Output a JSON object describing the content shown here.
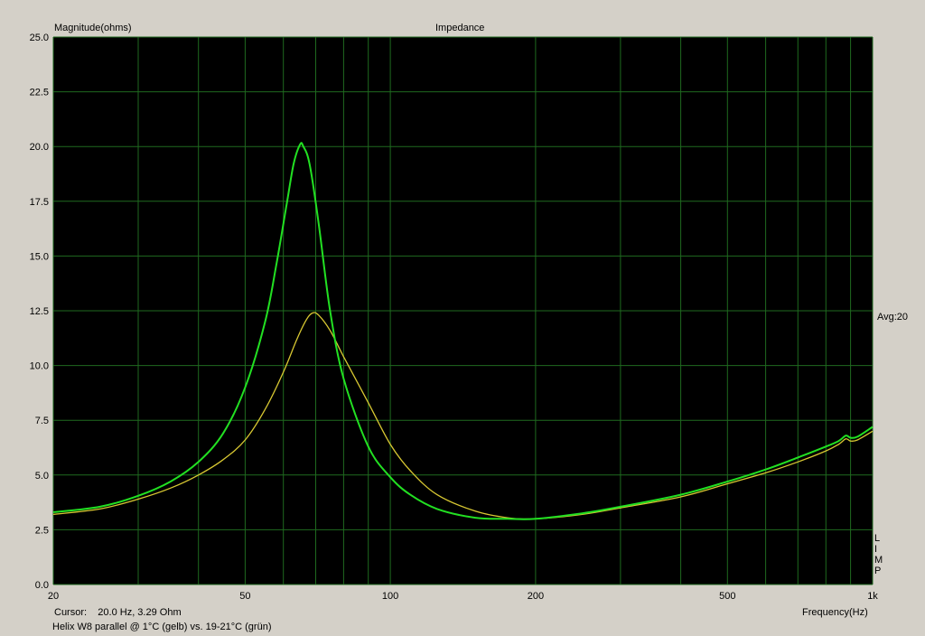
{
  "chart_data": {
    "type": "line",
    "title": "Impedance",
    "ylabel": "Magnitude(ohms)",
    "xlabel": "Frequency(Hz)",
    "x_scale": "log",
    "xlim": [
      20,
      1000
    ],
    "ylim": [
      0,
      25
    ],
    "x_ticks": [
      {
        "value": 20,
        "label": "20"
      },
      {
        "value": 50,
        "label": "50"
      },
      {
        "value": 100,
        "label": "100"
      },
      {
        "value": 200,
        "label": "200"
      },
      {
        "value": 500,
        "label": "500"
      },
      {
        "value": 1000,
        "label": "1k"
      }
    ],
    "x_gridlines": [
      20,
      30,
      40,
      50,
      60,
      70,
      80,
      90,
      100,
      200,
      300,
      400,
      500,
      600,
      700,
      800,
      900,
      1000
    ],
    "y_ticks": [
      "0.0",
      "2.5",
      "5.0",
      "7.5",
      "10.0",
      "12.5",
      "15.0",
      "17.5",
      "20.0",
      "22.5",
      "25.0"
    ],
    "grid": true,
    "background": "#000000",
    "grid_color": "#1f6a1f",
    "series": [
      {
        "color": "#d8c832",
        "points": [
          [
            20,
            3.2
          ],
          [
            25,
            3.45
          ],
          [
            30,
            3.9
          ],
          [
            35,
            4.4
          ],
          [
            40,
            5.0
          ],
          [
            45,
            5.7
          ],
          [
            50,
            6.6
          ],
          [
            55,
            8.0
          ],
          [
            60,
            9.7
          ],
          [
            64,
            11.2
          ],
          [
            67,
            12.1
          ],
          [
            69,
            12.4
          ],
          [
            71,
            12.3
          ],
          [
            75,
            11.6
          ],
          [
            80,
            10.4
          ],
          [
            90,
            8.3
          ],
          [
            100,
            6.4
          ],
          [
            110,
            5.2
          ],
          [
            125,
            4.1
          ],
          [
            150,
            3.35
          ],
          [
            175,
            3.05
          ],
          [
            200,
            3.0
          ],
          [
            250,
            3.2
          ],
          [
            300,
            3.5
          ],
          [
            400,
            4.0
          ],
          [
            500,
            4.6
          ],
          [
            600,
            5.1
          ],
          [
            700,
            5.6
          ],
          [
            800,
            6.1
          ],
          [
            850,
            6.4
          ],
          [
            880,
            6.65
          ],
          [
            900,
            6.55
          ],
          [
            930,
            6.6
          ],
          [
            1000,
            7.0
          ]
        ]
      },
      {
        "color": "#22e022",
        "points": [
          [
            20,
            3.3
          ],
          [
            25,
            3.55
          ],
          [
            30,
            4.05
          ],
          [
            35,
            4.7
          ],
          [
            40,
            5.6
          ],
          [
            45,
            6.9
          ],
          [
            50,
            9.0
          ],
          [
            55,
            12.0
          ],
          [
            58,
            14.6
          ],
          [
            61,
            17.4
          ],
          [
            63,
            19.2
          ],
          [
            65,
            20.1
          ],
          [
            66,
            20.0
          ],
          [
            68,
            19.2
          ],
          [
            71,
            16.5
          ],
          [
            75,
            12.5
          ],
          [
            80,
            9.4
          ],
          [
            90,
            6.3
          ],
          [
            100,
            4.9
          ],
          [
            110,
            4.1
          ],
          [
            125,
            3.45
          ],
          [
            150,
            3.05
          ],
          [
            175,
            3.0
          ],
          [
            200,
            3.0
          ],
          [
            250,
            3.25
          ],
          [
            300,
            3.55
          ],
          [
            400,
            4.1
          ],
          [
            500,
            4.7
          ],
          [
            600,
            5.25
          ],
          [
            700,
            5.8
          ],
          [
            800,
            6.3
          ],
          [
            850,
            6.55
          ],
          [
            880,
            6.8
          ],
          [
            900,
            6.7
          ],
          [
            930,
            6.75
          ],
          [
            1000,
            7.2
          ]
        ]
      }
    ]
  },
  "labels": {
    "title": "Impedance",
    "ylabel": "Magnitude(ohms)",
    "xlabel": "Frequency(Hz)",
    "avg": "Avg:20",
    "cursor": "Cursor:    20.0 Hz, 3.29 Ohm",
    "description": "Helix W8 parallel @ 1°C (gelb) vs. 19-21°C (grün)",
    "side_letters": [
      "L",
      "I",
      "M",
      "P"
    ]
  }
}
